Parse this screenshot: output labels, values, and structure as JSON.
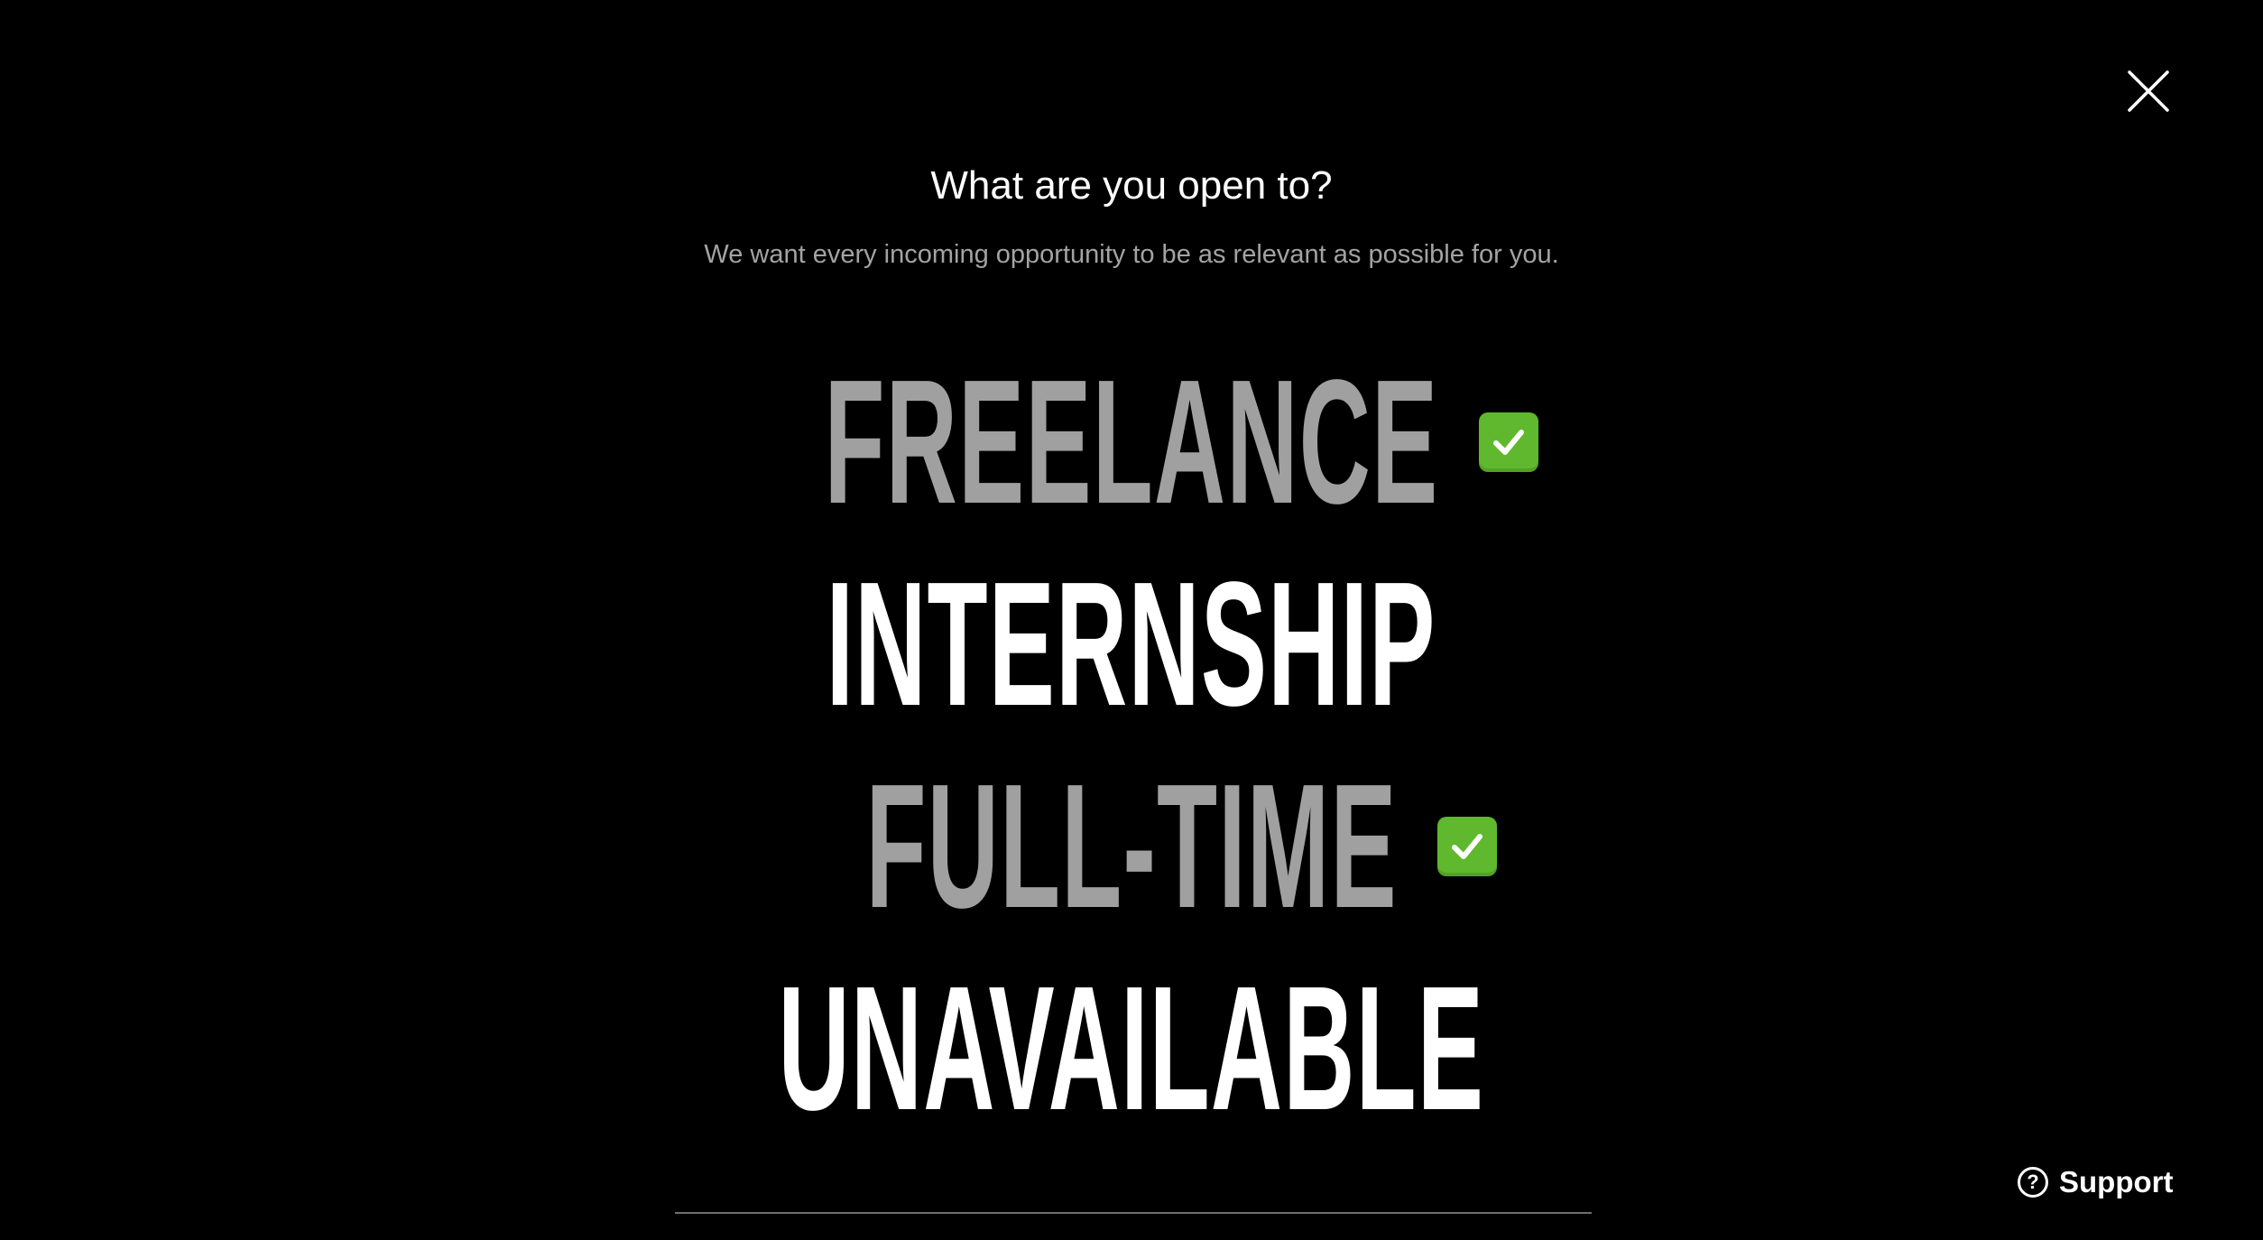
{
  "dialog": {
    "title": "What are you open to?",
    "subtitle": "We want every incoming opportunity to be as relevant as possible for you.",
    "close_icon": "close-icon"
  },
  "options": [
    {
      "label": "FREELANCE",
      "selected": true
    },
    {
      "label": "INTERNSHIP",
      "selected": false
    },
    {
      "label": "FULL-TIME",
      "selected": true
    },
    {
      "label": "UNAVAILABLE",
      "selected": false
    }
  ],
  "support": {
    "label": "Support",
    "icon": "question-circle-icon",
    "icon_glyph": "?"
  },
  "colors": {
    "background": "#000000",
    "selected_text": "#a0a0a0",
    "unselected_text": "#ffffff",
    "subtitle_text": "#a3a3a3",
    "check_green": "#5fb82d"
  }
}
